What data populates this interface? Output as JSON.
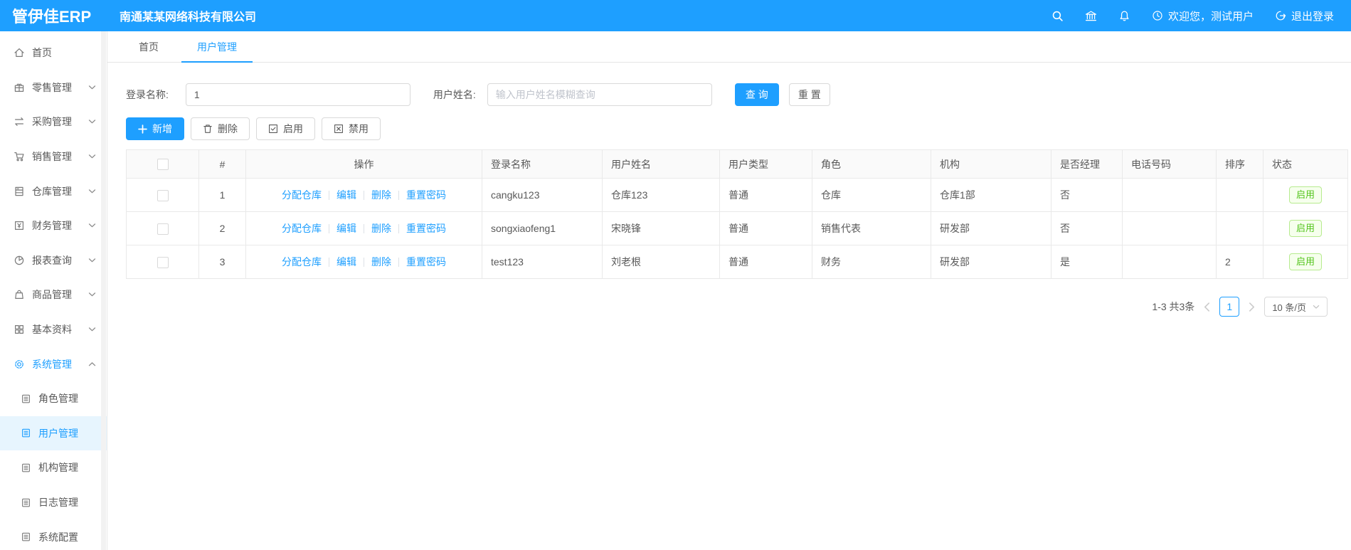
{
  "colors": {
    "primary": "#1E9FFF",
    "success_green": "#52C41A"
  },
  "header": {
    "logo": "管伊佳ERP",
    "company": "南通某某网络科技有限公司",
    "welcome": "欢迎您，测试用户",
    "logout": "退出登录"
  },
  "sidebar": {
    "items": [
      {
        "label": "首页",
        "icon": "home-icon"
      },
      {
        "label": "零售管理",
        "icon": "gift-icon"
      },
      {
        "label": "采购管理",
        "icon": "swap-icon"
      },
      {
        "label": "销售管理",
        "icon": "cart-icon"
      },
      {
        "label": "仓库管理",
        "icon": "warehouse-icon"
      },
      {
        "label": "财务管理",
        "icon": "finance-icon"
      },
      {
        "label": "报表查询",
        "icon": "pie-chart-icon"
      },
      {
        "label": "商品管理",
        "icon": "bag-icon"
      },
      {
        "label": "基本资料",
        "icon": "grid-icon"
      },
      {
        "label": "系统管理",
        "icon": "gear-icon",
        "expanded": true,
        "active": true,
        "children": [
          {
            "label": "角色管理",
            "icon": "doc-icon"
          },
          {
            "label": "用户管理",
            "icon": "doc-icon",
            "active": true
          },
          {
            "label": "机构管理",
            "icon": "doc-icon"
          },
          {
            "label": "日志管理",
            "icon": "doc-icon"
          },
          {
            "label": "系统配置",
            "icon": "doc-icon"
          }
        ]
      }
    ]
  },
  "tabs": [
    {
      "label": "首页"
    },
    {
      "label": "用户管理",
      "active": true
    }
  ],
  "filter": {
    "login_name_label": "登录名称:",
    "login_name_value": "1",
    "user_name_label": "用户姓名:",
    "user_name_placeholder": "输入用户姓名模糊查询",
    "search_label": "查 询",
    "reset_label": "重 置"
  },
  "toolbar": {
    "add_label": "新增",
    "delete_label": "删除",
    "enable_label": "启用",
    "disable_label": "禁用"
  },
  "table": {
    "columns": [
      "#",
      "操作",
      "登录名称",
      "用户姓名",
      "用户类型",
      "角色",
      "机构",
      "是否经理",
      "电话号码",
      "排序",
      "状态"
    ],
    "action_links": [
      "分配仓库",
      "编辑",
      "删除",
      "重置密码"
    ],
    "rows": [
      {
        "index": "1",
        "login": "cangku123",
        "name": "仓库123",
        "type": "普通",
        "role": "仓库",
        "org": "仓库1部",
        "manager": "否",
        "phone": "",
        "sort": "",
        "status": "启用"
      },
      {
        "index": "2",
        "login": "songxiaofeng1",
        "name": "宋晓锋",
        "type": "普通",
        "role": "销售代表",
        "org": "研发部",
        "manager": "否",
        "phone": "",
        "sort": "",
        "status": "启用"
      },
      {
        "index": "3",
        "login": "test123",
        "name": "刘老根",
        "type": "普通",
        "role": "财务",
        "org": "研发部",
        "manager": "是",
        "phone": "",
        "sort": "2",
        "status": "启用"
      }
    ]
  },
  "pagination": {
    "total": "1-3 共3条",
    "page": "1",
    "page_size": "10 条/页"
  }
}
